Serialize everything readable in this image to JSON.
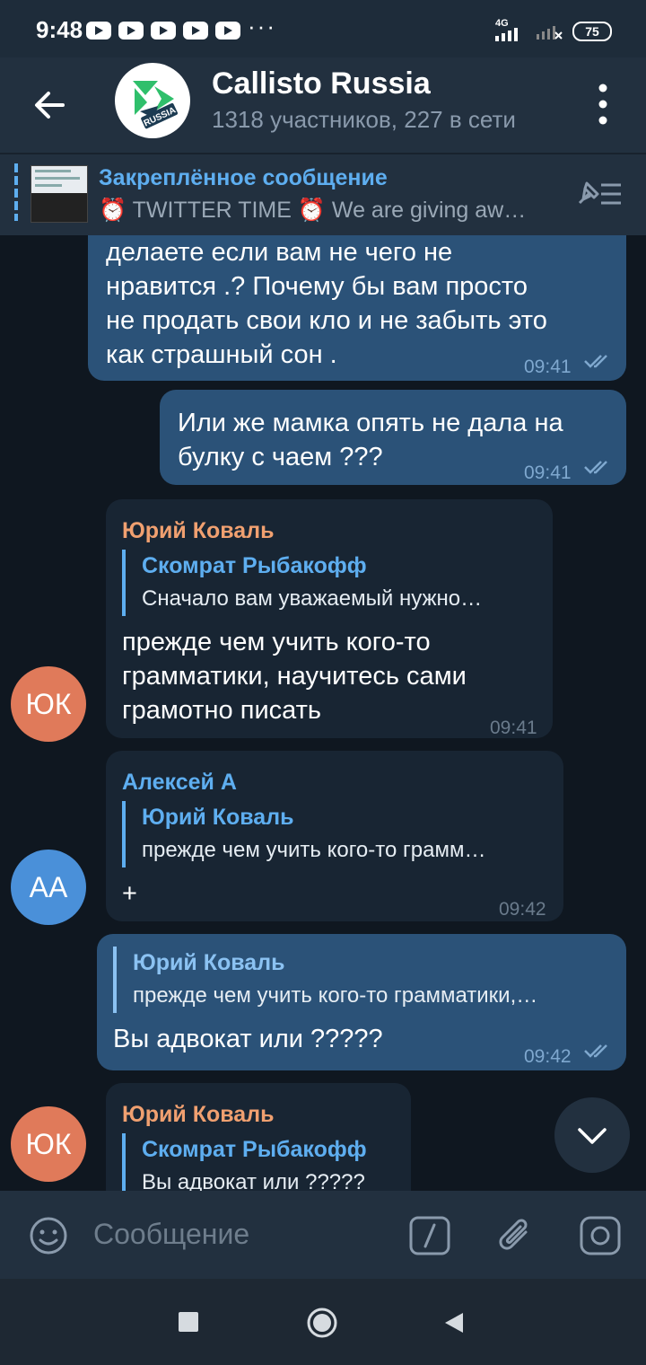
{
  "status_bar": {
    "time": "9:48",
    "network": "4G",
    "battery": "75"
  },
  "header": {
    "logo_text": "RUSSIA",
    "title": "Callisto Russia",
    "subtitle": "1318 участников, 227 в сети"
  },
  "pinned": {
    "title": "Закреплённое сообщение",
    "text": "⏰ TWITTER TIME ⏰ We are giving aw…"
  },
  "messages": [
    {
      "type": "out",
      "text_lines": [
        "делаете если вам не чего не",
        "нравится .? Почему бы вам просто",
        "не продать свои кло и не забыть это",
        "как страшный сон ."
      ],
      "time": "09:41"
    },
    {
      "type": "out",
      "text_lines": [
        "Или же мамка опять не дала на",
        "булку с чаем ???"
      ],
      "time": "09:41"
    },
    {
      "type": "in",
      "sender": "Юрий Коваль",
      "reply_name": "Скомрат Рыбакофф",
      "reply_text": "Сначало вам уважаемый нужно…",
      "text_lines": [
        "прежде чем учить кого-то",
        "грамматики, научитесь сами",
        "грамотно писать"
      ],
      "time": "09:41",
      "avatar": "ЮК"
    },
    {
      "type": "in",
      "sender": "Алексей А",
      "reply_name": "Юрий Коваль",
      "reply_text": "прежде чем учить кого-то грамм…",
      "text_lines": [
        "+"
      ],
      "time": "09:42",
      "avatar": "АА"
    },
    {
      "type": "out",
      "reply_name": "Юрий Коваль",
      "reply_text": "прежде чем учить кого-то грамматики,…",
      "text_lines": [
        "Вы адвокат или ?????"
      ],
      "time": "09:42"
    },
    {
      "type": "in",
      "sender": "Юрий Коваль",
      "reply_name": "Скомрат Рыбакофф",
      "reply_text": "Вы адвокат или ?????",
      "avatar": "ЮК"
    }
  ],
  "input": {
    "placeholder": "Сообщение"
  },
  "colors": {
    "out_bubble": "#2b5278",
    "in_bubble": "#182533",
    "accent": "#5eaef0",
    "sender_orange": "#f0a070",
    "sender_blue": "#5eaef0",
    "avatar_orange": "#e07a5a",
    "avatar_blue": "#4a90d9"
  },
  "icons": [
    "back-arrow-icon",
    "more-vert-icon",
    "unpin-icon",
    "emoji-icon",
    "bot-command-icon",
    "attach-icon",
    "camera-icon",
    "scroll-down-icon",
    "read-check-icon"
  ]
}
